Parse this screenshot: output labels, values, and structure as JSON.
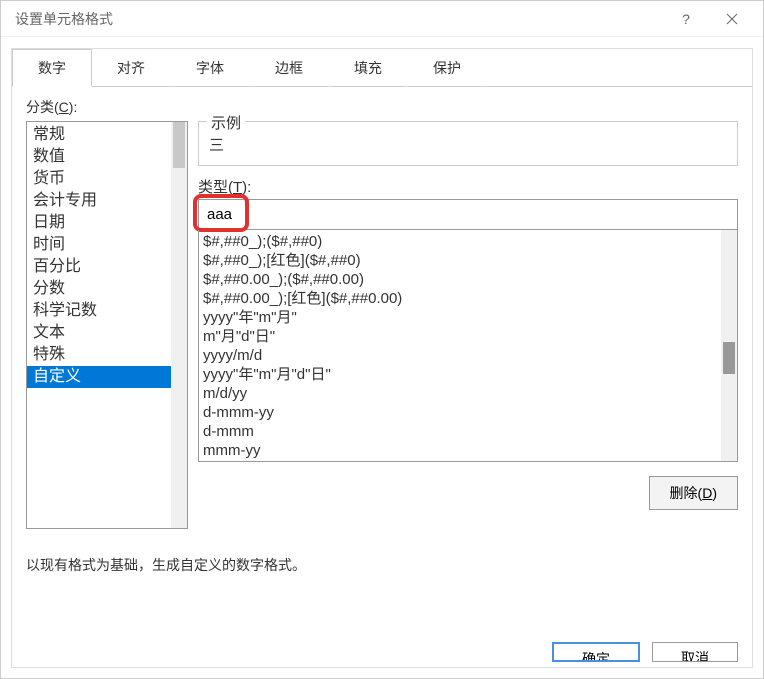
{
  "titlebar": {
    "title": "设置单元格格式"
  },
  "tabs": {
    "items": [
      {
        "label": "数字"
      },
      {
        "label": "对齐"
      },
      {
        "label": "字体"
      },
      {
        "label": "边框"
      },
      {
        "label": "填充"
      },
      {
        "label": "保护"
      }
    ],
    "active_index": 0
  },
  "category": {
    "label_prefix": "分类(",
    "label_hotkey": "C",
    "label_suffix": "):",
    "items": [
      "常规",
      "数值",
      "货币",
      "会计专用",
      "日期",
      "时间",
      "百分比",
      "分数",
      "科学记数",
      "文本",
      "特殊",
      "自定义"
    ],
    "selected_index": 11
  },
  "example": {
    "label": "示例",
    "value": "三"
  },
  "type": {
    "label_prefix": "类型(",
    "label_hotkey": "T",
    "label_suffix": "):",
    "value": "aaa"
  },
  "formats": [
    "$#,##0_);($#,##0)",
    "$#,##0_);[红色]($#,##0)",
    "$#,##0.00_);($#,##0.00)",
    "$#,##0.00_);[红色]($#,##0.00)",
    "yyyy\"年\"m\"月\"",
    "m\"月\"d\"日\"",
    "yyyy/m/d",
    "yyyy\"年\"m\"月\"d\"日\"",
    "m/d/yy",
    "d-mmm-yy",
    "d-mmm",
    "mmm-yy"
  ],
  "delete": {
    "label_prefix": "删除(",
    "label_hotkey": "D",
    "label_suffix": ")"
  },
  "hint": "以现有格式为基础，生成自定义的数字格式。",
  "buttons": {
    "ok": "确定",
    "cancel": "取消"
  }
}
